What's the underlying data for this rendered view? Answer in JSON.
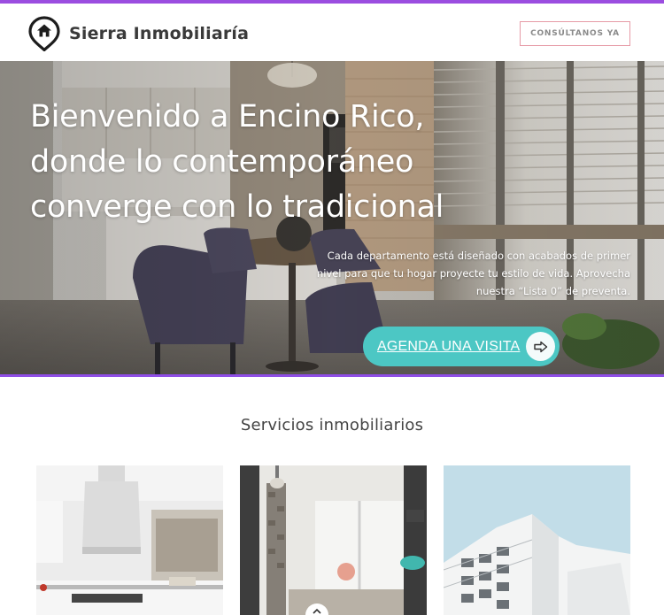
{
  "header": {
    "brand": "Sierra Inmobiliaría",
    "cta_label": "CONSÚLTANOS YA"
  },
  "hero": {
    "title_line1": "Bienvenido a Encino Rico,",
    "title_line2": "donde lo contemporáneo",
    "title_line3": "converge con lo tradicional",
    "description": "Cada departamento está diseñado con acabados de primer nivel para que tu hogar proyecte tu estilo de vida. Aprovecha nuestra “Lista 0” de preventa.",
    "visit_label": "AGENDA UNA VISITA"
  },
  "services": {
    "title": "Servicios inmobiliarios",
    "cards": [
      {
        "image": "modern-kitchen-photo"
      },
      {
        "image": "apartment-living-room-photo"
      },
      {
        "image": "white-building-facade-photo"
      }
    ]
  },
  "icons": {
    "logo": "home-pin-icon",
    "visit_arrow": "arrow-right-icon",
    "scroll": "chevron-up-icon"
  },
  "colors": {
    "accent_purple": "#9b4de0",
    "teal": "#4cc7c4",
    "cta_border": "#e69aa6"
  }
}
